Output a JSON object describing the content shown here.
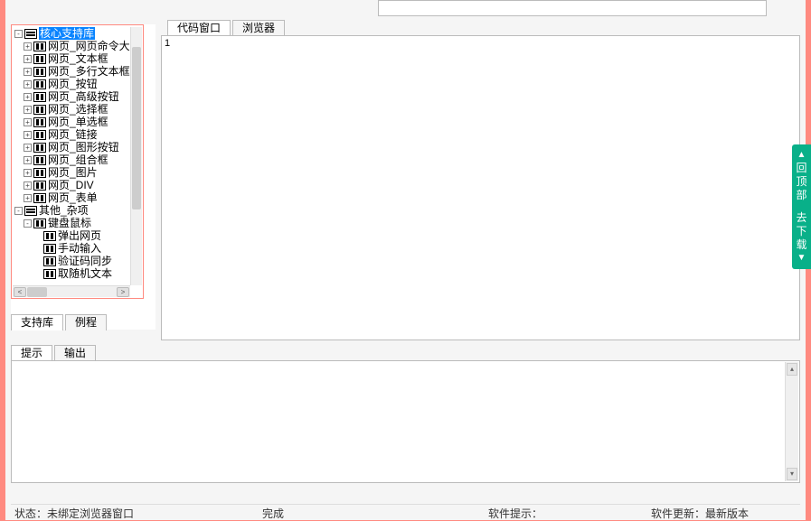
{
  "left_tree": {
    "root1": "核心支持库",
    "items1": [
      "网页_网页命令大全",
      "网页_文本框",
      "网页_多行文本框",
      "网页_按钮",
      "网页_高级按钮",
      "网页_选择框",
      "网页_单选框",
      "网页_链接",
      "网页_图形按钮",
      "网页_组合框",
      "网页_图片",
      "网页_DIV",
      "网页_表单"
    ],
    "root2": "其他_杂项",
    "items2": [
      "键盘鼠标",
      "弹出网页",
      "手动输入",
      "验证码同步",
      "取随机文本"
    ]
  },
  "left_tabs": {
    "t1": "支持库",
    "t2": "例程"
  },
  "right_tabs": {
    "t1": "代码窗口",
    "t2": "浏览器"
  },
  "code_lineno": "1",
  "bottom_tabs": {
    "t1": "提示",
    "t2": "输出"
  },
  "status": {
    "c1": "状态：未绑定浏览器窗口",
    "c2": "完成",
    "c3": "软件提示：",
    "c4": "软件更新：最新版本"
  },
  "side": {
    "arrow_up": "▲",
    "top_text": "回顶部",
    "dl_text": "去下载",
    "arrow_dn": "▼"
  }
}
